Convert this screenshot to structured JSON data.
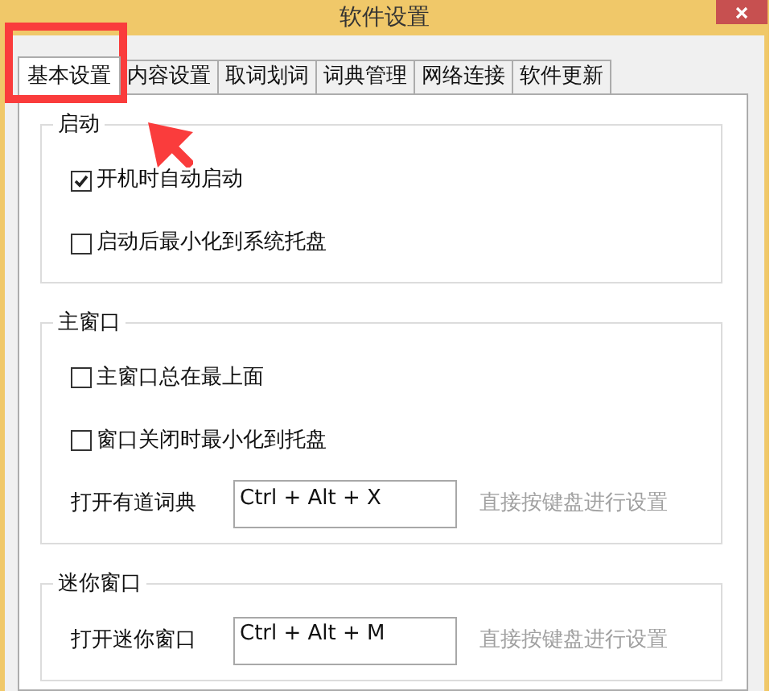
{
  "window": {
    "title": "软件设置"
  },
  "tabs": [
    {
      "label": "基本设置",
      "selected": true
    },
    {
      "label": "内容设置",
      "selected": false
    },
    {
      "label": "取词划词",
      "selected": false
    },
    {
      "label": "词典管理",
      "selected": false
    },
    {
      "label": "网络连接",
      "selected": false
    },
    {
      "label": "软件更新",
      "selected": false
    }
  ],
  "groups": [
    {
      "title": "启动",
      "items": [
        {
          "kind": "checkbox",
          "label": "开机时自动启动",
          "checked": true
        },
        {
          "kind": "checkbox",
          "label": "启动后最小化到系统托盘",
          "checked": false
        }
      ]
    },
    {
      "title": "主窗口",
      "items": [
        {
          "kind": "checkbox",
          "label": "主窗口总在最上面",
          "checked": false
        },
        {
          "kind": "checkbox",
          "label": "窗口关闭时最小化到托盘",
          "checked": false
        },
        {
          "kind": "hotkey",
          "label": "打开有道词典",
          "value": "Ctrl + Alt + X",
          "hint": "直接按键盘进行设置"
        }
      ]
    },
    {
      "title": "迷你窗口",
      "items": [
        {
          "kind": "hotkey",
          "label": "打开迷你窗口",
          "value": "Ctrl + Alt + M",
          "hint": "直接按键盘进行设置"
        }
      ]
    }
  ]
}
